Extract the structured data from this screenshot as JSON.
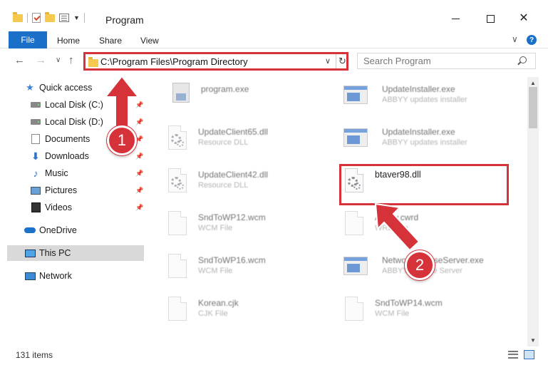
{
  "window": {
    "title": "Program",
    "min_label": "",
    "max_label": "",
    "close_label": "✕"
  },
  "ribbon": {
    "file": "File",
    "tabs": [
      "Home",
      "Share",
      "View"
    ]
  },
  "navigation": {
    "address": "C:\\Program Files\\Program Directory",
    "search_placeholder": "Search Program"
  },
  "sidebar": {
    "items": [
      {
        "label": "Quick access",
        "icon": "star-icon",
        "pinned": false
      },
      {
        "label": "Local Disk (C:)",
        "icon": "drive-icon",
        "pinned": true
      },
      {
        "label": "Local Disk (D:)",
        "icon": "drive-icon",
        "pinned": true
      },
      {
        "label": "Documents",
        "icon": "documents-icon",
        "pinned": true
      },
      {
        "label": "Downloads",
        "icon": "downloads-icon",
        "pinned": true
      },
      {
        "label": "Music",
        "icon": "music-icon",
        "pinned": true
      },
      {
        "label": "Pictures",
        "icon": "pictures-icon",
        "pinned": true
      },
      {
        "label": "Videos",
        "icon": "videos-icon",
        "pinned": true
      },
      {
        "label": "OneDrive",
        "icon": "onedrive-icon",
        "pinned": false
      },
      {
        "label": "This PC",
        "icon": "this-pc-icon",
        "pinned": false,
        "selected": true
      },
      {
        "label": "Network",
        "icon": "network-icon",
        "pinned": false
      }
    ]
  },
  "files": {
    "left": [
      {
        "name": "program.exe",
        "type": "",
        "icon": "program-icon"
      },
      {
        "name": "UpdateClient65.dll",
        "type": "Resource DLL",
        "icon": "dll-icon"
      },
      {
        "name": "UpdateClient42.dll",
        "type": "Resource DLL",
        "icon": "dll-icon"
      },
      {
        "name": "SndToWP12.wcm",
        "type": "WCM File",
        "icon": "file-icon"
      },
      {
        "name": "SndToWP16.wcm",
        "type": "WCM File",
        "icon": "file-icon"
      },
      {
        "name": "Korean.cjk",
        "type": "CJK File",
        "icon": "file-icon"
      }
    ],
    "right": [
      {
        "name": "UpdateInstaller.exe",
        "type": "ABBYY updates installer",
        "icon": "exe-icon"
      },
      {
        "name": "UpdateInstaller.exe",
        "type": "ABBYY updates installer",
        "icon": "exe-icon"
      },
      {
        "name": "btaver98.dll",
        "type": "",
        "icon": "dll-icon",
        "highlighted": true
      },
      {
        "name": "Abbyy.cwrd",
        "type": "WRD File",
        "icon": "file-icon"
      },
      {
        "name": "NetworkLicenseServer.exe",
        "type": "ABBYY License Server",
        "icon": "exe-icon"
      },
      {
        "name": "SndToWP14.wcm",
        "type": "WCM File",
        "icon": "file-icon"
      }
    ]
  },
  "status": {
    "items_count": "131 items"
  },
  "annotations": {
    "step1": "1",
    "step2": "2",
    "color": "#d6323a"
  }
}
